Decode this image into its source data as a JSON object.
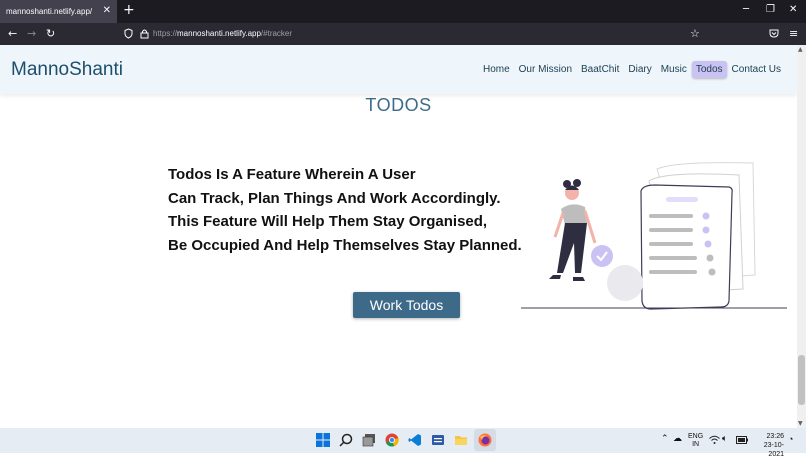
{
  "browser": {
    "tab_title": "mannoshanti.netlify.app/",
    "url_prefix": "https://",
    "url_host": "mannoshanti.netlify.app",
    "url_path": "/#tracker"
  },
  "site": {
    "brand": "MannoShanti",
    "nav": [
      {
        "label": "Home"
      },
      {
        "label": "Our Mission"
      },
      {
        "label": "BaatChit"
      },
      {
        "label": "Diary"
      },
      {
        "label": "Music"
      },
      {
        "label": "Todos",
        "active": true
      },
      {
        "label": "Contact Us"
      }
    ],
    "active_color": "#c9c2f2"
  },
  "section": {
    "title": "TODOS",
    "lines": [
      "Todos Is A Feature Wherein A User",
      "Can Track, Plan Things And Work Accordingly.",
      "This Feature Will Help Them Stay Organised,",
      "Be Occupied And Help Themselves Stay Planned."
    ],
    "button_label": "Work Todos",
    "button_color": "#3e6a8a"
  },
  "taskbar": {
    "lang_top": "ENG",
    "lang_bottom": "IN",
    "time": "23:26",
    "date": "23-10-2021"
  }
}
